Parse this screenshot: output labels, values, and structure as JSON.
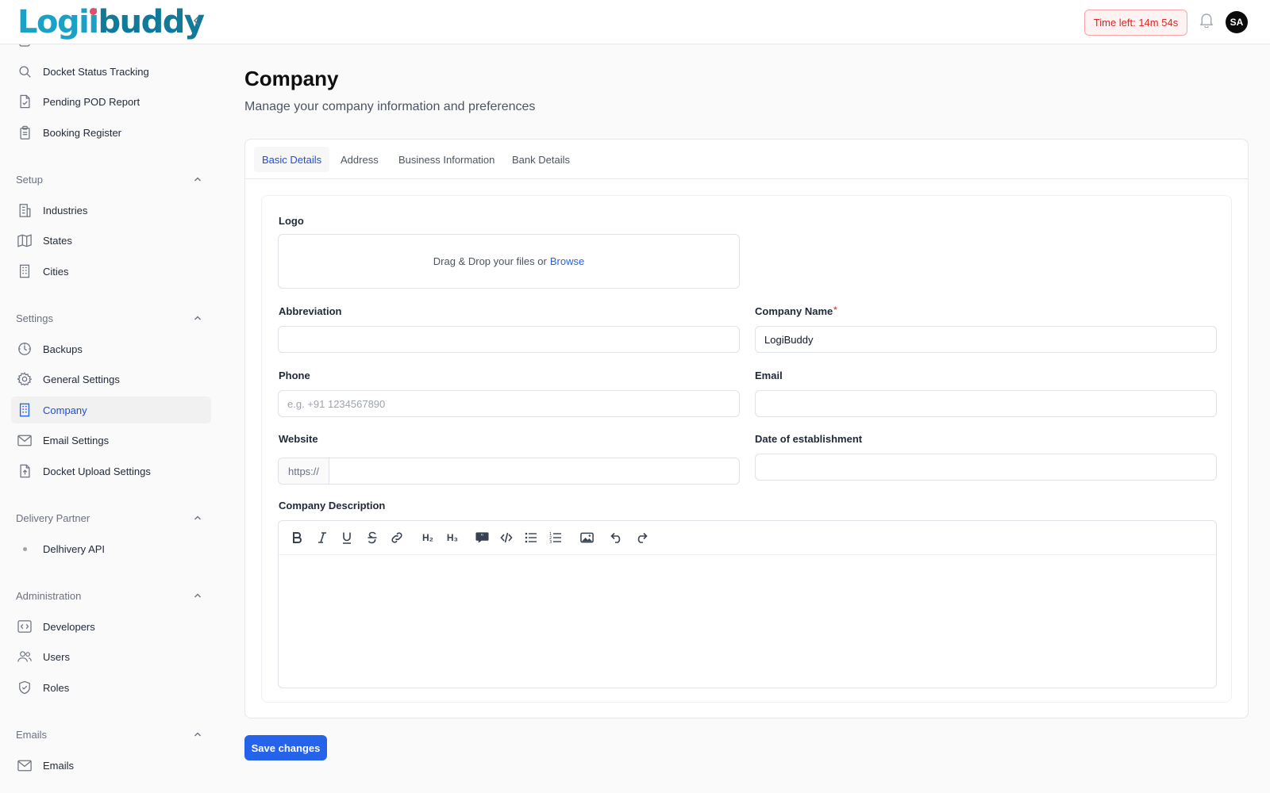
{
  "app": {
    "logo_part1": "Logi",
    "logo_i": "i",
    "logo_part2": "buddy"
  },
  "header": {
    "timer": "Time left: 14m 54s",
    "avatar": "SA"
  },
  "sidebar": {
    "items_top": [
      {
        "label": "Docket Status Tracking",
        "icon": "search-icon"
      },
      {
        "label": "Pending POD Report",
        "icon": "file-check-icon"
      },
      {
        "label": "Booking Register",
        "icon": "clipboard-icon"
      }
    ],
    "sections": {
      "setup": {
        "title": "Setup",
        "items": [
          "Industries",
          "States",
          "Cities"
        ]
      },
      "settings": {
        "title": "Settings",
        "items": [
          "Backups",
          "General Settings",
          "Company",
          "Email Settings",
          "Docket Upload Settings"
        ]
      },
      "delivery": {
        "title": "Delivery Partner",
        "items": [
          "Delhivery API"
        ]
      },
      "administration": {
        "title": "Administration",
        "items": [
          "Developers",
          "Users",
          "Roles"
        ]
      },
      "emails": {
        "title": "Emails",
        "items": [
          "Emails"
        ]
      }
    },
    "active_item": "Company",
    "accent_color": "#2563eb"
  },
  "page": {
    "title": "Company",
    "subtitle": "Manage your company information and preferences"
  },
  "tabs": [
    {
      "label": "Basic Details",
      "active": true
    },
    {
      "label": "Address",
      "active": false
    },
    {
      "label": "Business Information",
      "active": false
    },
    {
      "label": "Bank Details",
      "active": false
    }
  ],
  "form": {
    "logo": {
      "label": "Logo",
      "drop_text": "Drag & Drop your files or",
      "browse": "Browse"
    },
    "abbreviation": {
      "label": "Abbreviation",
      "value": ""
    },
    "company_name": {
      "label": "Company Name",
      "required_mark": "*",
      "value": "LogiBuddy"
    },
    "phone": {
      "label": "Phone",
      "placeholder": "e.g. +91 1234567890",
      "value": ""
    },
    "email": {
      "label": "Email",
      "value": ""
    },
    "website": {
      "label": "Website",
      "prefix": "https://",
      "value": ""
    },
    "date_established": {
      "label": "Date of establishment",
      "value": ""
    },
    "description": {
      "label": "Company Description",
      "toolbar": [
        "bold-icon",
        "italic-icon",
        "underline-icon",
        "strikethrough-icon",
        "link-icon",
        "heading-2-icon",
        "heading-3-icon",
        "blockquote-icon",
        "code-icon",
        "bullet-list-icon",
        "ordered-list-icon",
        "image-icon",
        "undo-icon",
        "redo-icon"
      ],
      "toolbar_h2": "H₂",
      "toolbar_h3": "H₃",
      "value": ""
    }
  },
  "actions": {
    "save": "Save changes"
  }
}
